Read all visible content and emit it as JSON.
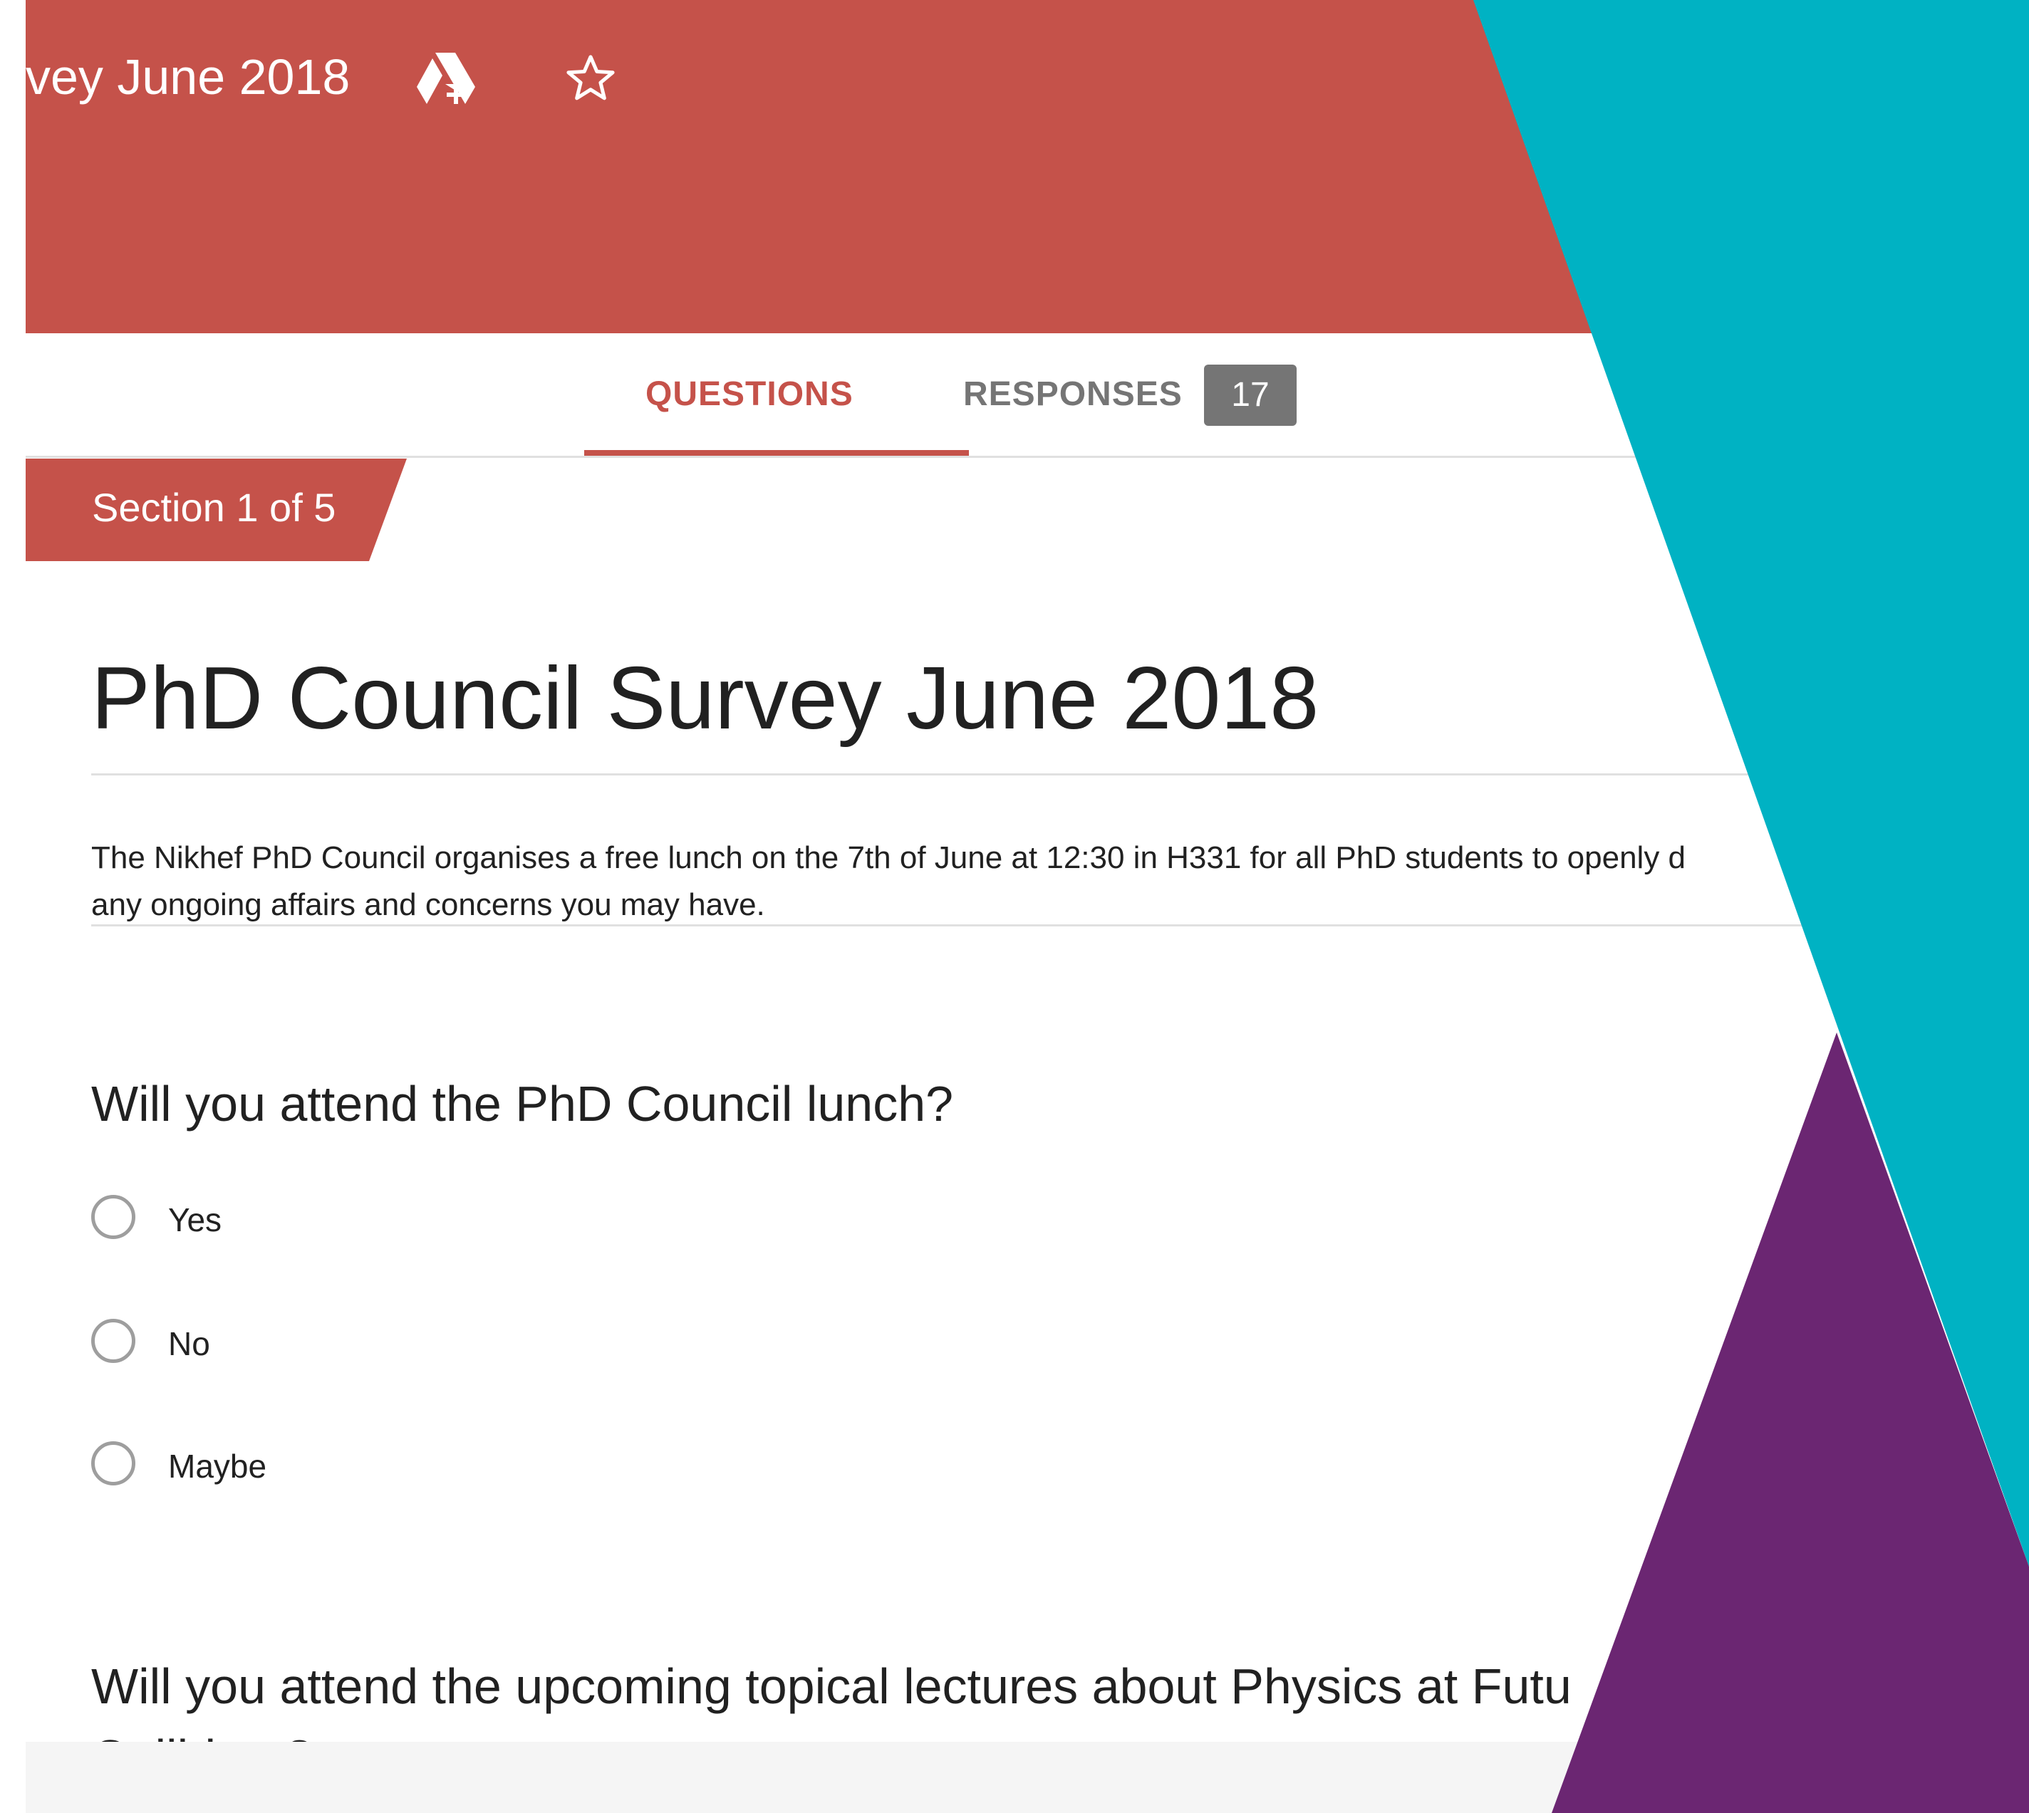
{
  "header": {
    "doc_title": "vey June 2018",
    "drive_icon": "add-to-drive-icon",
    "star_icon": "star-outline-icon",
    "color": "#c5524a"
  },
  "tabs": {
    "questions_label": "QUESTIONS",
    "responses_label": "RESPONSES",
    "responses_count": "17"
  },
  "section": {
    "label": "Section 1 of 5"
  },
  "form": {
    "title": "PhD Council Survey June 2018",
    "description_line1": "The Nikhef PhD Council organises a free lunch on the 7th of June at 12:30 in H331 for all PhD students to openly d",
    "description_line2": "any ongoing affairs and concerns you may have."
  },
  "questions": [
    {
      "title": "Will you attend the PhD Council lunch?",
      "options": [
        "Yes",
        "No",
        "Maybe"
      ]
    },
    {
      "title_line1": "Will you attend the upcoming topical lectures about Physics at Futu",
      "title_line2": "Colliders?"
    }
  ],
  "decor": {
    "teal": "#00b2c3",
    "purple": "#6b2672"
  }
}
